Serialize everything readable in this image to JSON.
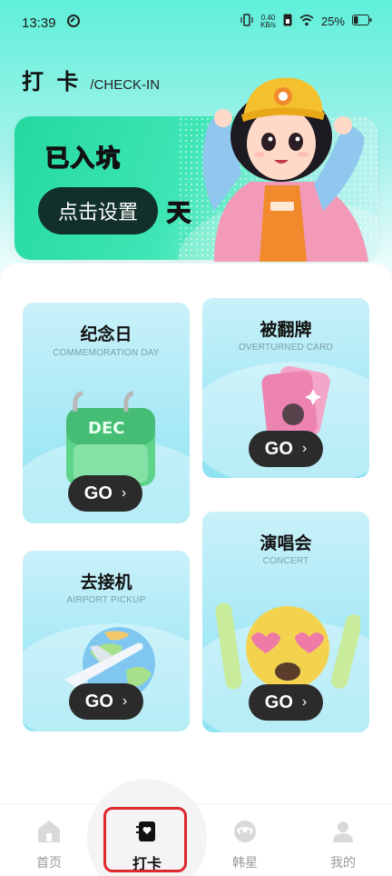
{
  "status_bar": {
    "time": "13:39",
    "net_speed_value": "0.40",
    "net_speed_unit": "KB/s",
    "battery": "25%"
  },
  "header": {
    "title": "打 卡",
    "subtitle": "/CHECK-IN"
  },
  "banner": {
    "title": "已入坑",
    "button_label": "点击设置",
    "unit": "天"
  },
  "cards": {
    "memorial": {
      "title": "纪念日",
      "subtitle": "COMMEMORATION DAY",
      "calendar_month": "DEC",
      "go_label": "GO"
    },
    "flip": {
      "title": "被翻牌",
      "subtitle": "OVERTURNED CARD",
      "go_label": "GO"
    },
    "airport": {
      "title": "去接机",
      "subtitle": "AIRPORT PICKUP",
      "go_label": "GO"
    },
    "concert": {
      "title": "演唱会",
      "subtitle": "CONCERT",
      "go_label": "GO"
    }
  },
  "bottom_nav": {
    "items": [
      {
        "label": "首页",
        "icon": "home-icon",
        "active": false
      },
      {
        "label": "打卡",
        "icon": "checkin-icon",
        "active": true
      },
      {
        "label": "韩星",
        "icon": "star-idol-icon",
        "active": false
      },
      {
        "label": "我的",
        "icon": "profile-icon",
        "active": false
      }
    ]
  },
  "colors": {
    "accent_green": "#24d89f",
    "card_blue": "#a8e9f6",
    "go_button": "#2b2b2b",
    "highlight_red": "#e0282f"
  }
}
